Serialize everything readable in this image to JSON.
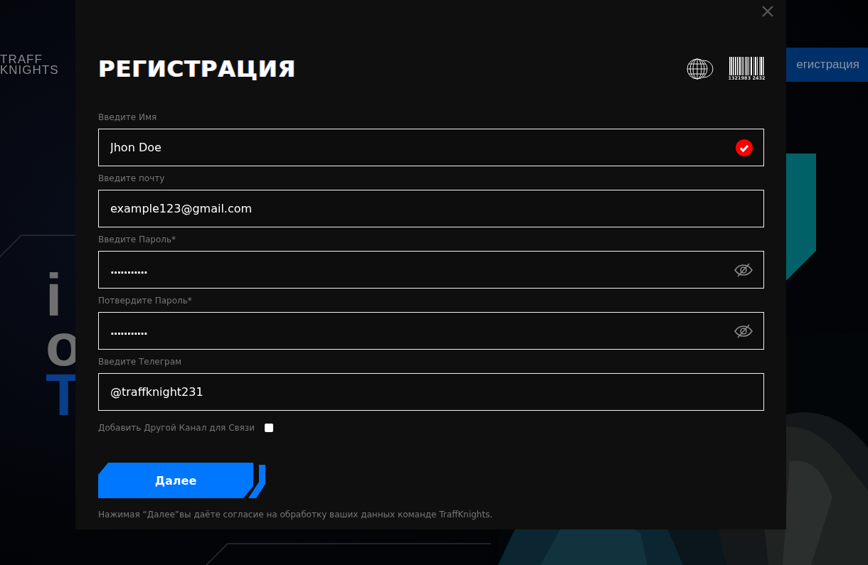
{
  "background": {
    "logo": [
      "TRAFF",
      "KNIGHTS"
    ],
    "header_button": "егистрация",
    "hero_lines": [
      "i",
      "o",
      "T"
    ],
    "photo": {
      "kind": "picture"
    }
  },
  "modal": {
    "title": "РЕГИСТРАЦИЯ",
    "barcode_number": "1321983 2432",
    "fields": [
      {
        "label": "Введите Имя",
        "value": "Jhon Doe",
        "kind": "text",
        "valid": true
      },
      {
        "label": "Введите почту",
        "value": "example123@gmail.com",
        "kind": "text",
        "valid": false
      },
      {
        "label": "Введите Пароль*",
        "value": "...........",
        "kind": "password",
        "valid": false
      },
      {
        "label": "Потвердите Пароль*",
        "value": "...........",
        "kind": "password",
        "valid": false
      },
      {
        "label": "Введите Телеграм",
        "value": "@traffknight231",
        "kind": "text",
        "valid": false
      }
    ],
    "extra_channel": {
      "label": "Добавить Другой Канал для Связи",
      "checked": false
    },
    "submit": "Далее",
    "consent": "Нажимая “Далее”вы даёте согласие на обработку ваших данных команде TraffKnights."
  }
}
